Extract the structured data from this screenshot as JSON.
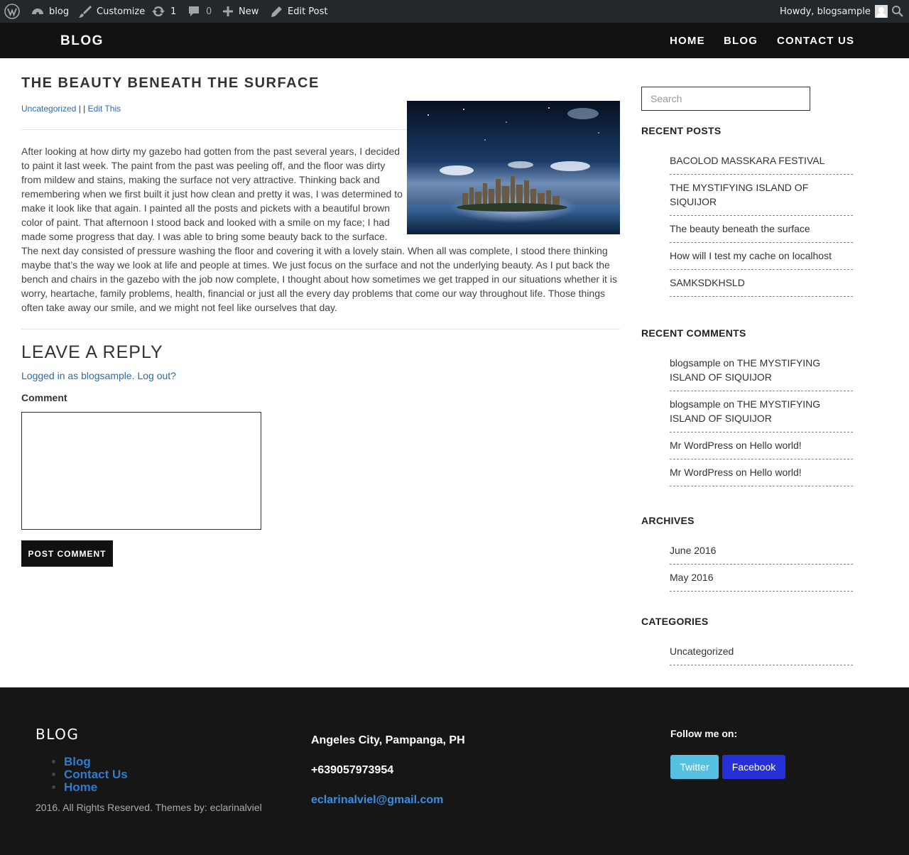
{
  "adminbar": {
    "site_name": "blog",
    "customize": "Customize",
    "updates_count": "1",
    "comments_count": "0",
    "new": "New",
    "edit_post": "Edit Post",
    "howdy": "Howdy, blogsample"
  },
  "header": {
    "site_title": "BLOG",
    "nav": [
      "HOME",
      "BLOG",
      "CONTACT US"
    ]
  },
  "post": {
    "title": "THE BEAUTY BENEATH THE SURFACE",
    "category": "Uncategorized",
    "meta_sep": " | | ",
    "edit_link": "Edit This",
    "body": "After looking at how dirty my gazebo had gotten from the past several years, I decided to paint it last week. The paint from the past was peeling off, and the floor was dirty from mildew and stains, making the surface not very attractive. Thinking back and remembering when we first built it just how clean and pretty it was, I was determined to make it look like that again. I painted all the posts and pickets with a beautiful brown color of paint.  That afternoon I stood back and looked with a smile on my face; I had made some progress that day. I was able to bring some beauty back to the surface. The next day consisted of pressure washing the floor and covering it with a lovely stain. When all was complete, I stood there thinking maybe that’s the way we look at life and people at times. We just focus on the surface and not the underlying beauty. As I put back the bench and chairs in the gazebo with the job now complete, I thought about how sometimes we get trapped in our situations whether it is worry, heartache, family problems, health, financial or just all the every day problems that come our way throughout life. Those things often take away our smile, and we might not feel like ourselves that day."
  },
  "reply": {
    "title": "LEAVE A REPLY",
    "logged_in_prefix": "Logged in as blogsample.",
    "logout": "Log out?",
    "comment_label": "Comment",
    "submit": "POST COMMENT"
  },
  "sidebar": {
    "search_placeholder": "Search",
    "recent_posts_title": "RECENT POSTS",
    "recent_posts": [
      "BACOLOD MASSKARA FESTIVAL",
      "THE MYSTIFYING ISLAND OF SIQUIJOR",
      "The beauty beneath the surface",
      "How will I test my cache on localhost",
      "SAMKSDKHSLD"
    ],
    "recent_comments_title": "RECENT COMMENTS",
    "recent_comments": [
      {
        "author": "blogsample",
        "on": " on ",
        "post": "THE MYSTIFYING ISLAND OF SIQUIJOR"
      },
      {
        "author": "blogsample",
        "on": " on ",
        "post": "THE MYSTIFYING ISLAND OF SIQUIJOR"
      },
      {
        "author": "Mr WordPress",
        "on": " on ",
        "post": "Hello world!"
      },
      {
        "author": "Mr WordPress",
        "on": " on ",
        "post": "Hello world!"
      }
    ],
    "archives_title": "ARCHIVES",
    "archives": [
      "June 2016",
      "May 2016"
    ],
    "categories_title": "CATEGORIES",
    "categories": [
      "Uncategorized"
    ]
  },
  "footer": {
    "title": "BLOG",
    "links": [
      "Blog",
      "Contact Us",
      "Home"
    ],
    "copyright": "2016. All Rights Reserved. Themes by: eclarinalviel",
    "address": "Angeles City, Pampanga, PH",
    "phone": "+639057973954",
    "email": "eclarinalviel@gmail.com",
    "follow": "Follow me on:",
    "twitter": "Twitter",
    "facebook": "Facebook"
  },
  "colors": {
    "admin_bar": "#23282d",
    "header": "#111111",
    "link": "#2b6cb0",
    "footer": "#161616",
    "twitter": "#55c0e0",
    "facebook": "#2530d8"
  }
}
